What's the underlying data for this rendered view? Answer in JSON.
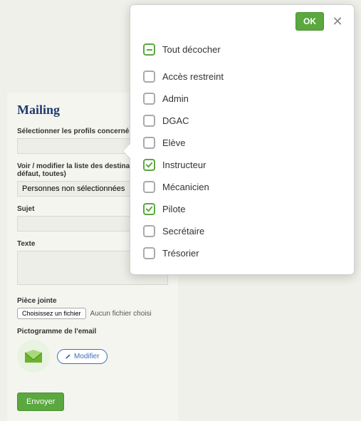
{
  "page_title": "Mailing",
  "form": {
    "profiles_label": "Sélectionner les profils concernés (ou)",
    "profiles_value": "",
    "recipients_label": "Voir / modifier la liste des destinataires (par défaut, toutes)",
    "recipients_value": "Personnes non sélectionnées",
    "subject_label": "Sujet",
    "subject_value": "",
    "body_label": "Texte",
    "body_value": "",
    "attachment_label": "Pièce jointe",
    "file_button": "Choisissez un fichier",
    "file_status": "Aucun fichier choisi",
    "picto_label": "Pictogramme de l'email",
    "modify_label": "Modifier",
    "send_label": "Envoyer"
  },
  "popover": {
    "ok_label": "OK",
    "uncheck_all_label": "Tout décocher",
    "options": [
      {
        "label": "Accès restreint",
        "checked": false
      },
      {
        "label": "Admin",
        "checked": false
      },
      {
        "label": "DGAC",
        "checked": false
      },
      {
        "label": "Elève",
        "checked": false
      },
      {
        "label": "Instructeur",
        "checked": true
      },
      {
        "label": "Mécanicien",
        "checked": false
      },
      {
        "label": "Pilote",
        "checked": true
      },
      {
        "label": "Secrétaire",
        "checked": false
      },
      {
        "label": "Trésorier",
        "checked": false
      }
    ]
  }
}
